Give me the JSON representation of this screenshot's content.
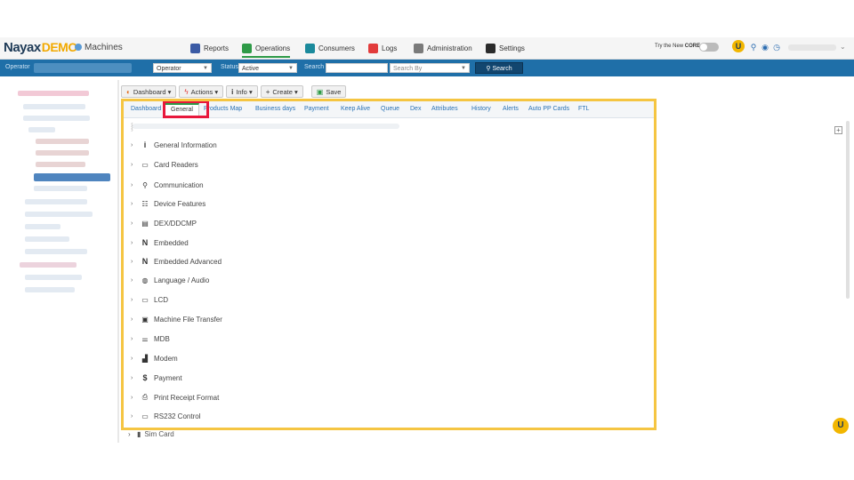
{
  "header": {
    "brand": "Nayax",
    "brand_suffix": "DEMO",
    "module": "Machines",
    "nav": [
      {
        "label": "Reports",
        "color": "#3b5ba5"
      },
      {
        "label": "Operations",
        "color": "#2e9a47"
      },
      {
        "label": "Consumers",
        "color": "#1b8a9c"
      },
      {
        "label": "Logs",
        "color": "#e23b3b"
      },
      {
        "label": "Administration",
        "color": "#7a7a7a"
      },
      {
        "label": "Settings",
        "color": "#2b2b2b"
      }
    ],
    "try_new_prefix": "Try the New",
    "try_new_brand": "CORE",
    "badge_letter": "U"
  },
  "filters": {
    "operator_label": "Operator",
    "operator_select": "Operator",
    "status_label": "Status",
    "status_value": "Active",
    "search_label": "Search",
    "search_by": "Search By",
    "search_button": "Search"
  },
  "toolbar": {
    "dashboard": "Dashboard",
    "actions": "Actions",
    "info": "Info",
    "create": "Create",
    "save": "Save"
  },
  "tabs": [
    "Dashboard",
    "General",
    "Products Map",
    "Business days",
    "Payment",
    "Keep Alive",
    "Queue",
    "Dex",
    "Attributes",
    "History",
    "Alerts",
    "Auto PP Cards",
    "FTL"
  ],
  "active_tab": "General",
  "sections": [
    {
      "label": "General Information",
      "icon": "info-icon",
      "glyph": "i"
    },
    {
      "label": "Card Readers",
      "icon": "card-reader-icon",
      "glyph": "▭"
    },
    {
      "label": "Communication",
      "icon": "antenna-icon",
      "glyph": "⚲"
    },
    {
      "label": "Device Features",
      "icon": "features-icon",
      "glyph": "☷"
    },
    {
      "label": "DEX/DDCMP",
      "icon": "dex-icon",
      "glyph": "▤"
    },
    {
      "label": "Embedded",
      "icon": "nayax-n-icon",
      "glyph": "N"
    },
    {
      "label": "Embedded Advanced",
      "icon": "nayax-n-icon",
      "glyph": "N"
    },
    {
      "label": "Language / Audio",
      "icon": "globe-audio-icon",
      "glyph": "◍"
    },
    {
      "label": "LCD",
      "icon": "lcd-icon",
      "glyph": "▭"
    },
    {
      "label": "Machine File Transfer",
      "icon": "file-transfer-icon",
      "glyph": "▣"
    },
    {
      "label": "MDB",
      "icon": "mdb-icon",
      "glyph": "⚌"
    },
    {
      "label": "Modem",
      "icon": "modem-icon",
      "glyph": "▟"
    },
    {
      "label": "Payment",
      "icon": "payment-icon",
      "glyph": "$"
    },
    {
      "label": "Print Receipt Format",
      "icon": "printer-icon",
      "glyph": "⎙"
    },
    {
      "label": "RS232 Control",
      "icon": "rs232-icon",
      "glyph": "▭"
    }
  ],
  "below_section": {
    "label": "Sim Card",
    "icon": "sim-card-icon",
    "glyph": "▮"
  },
  "colors": {
    "highlight_frame": "#f5c542",
    "annotation_box": "#e8183c",
    "filter_bar": "#1f6fa8"
  }
}
